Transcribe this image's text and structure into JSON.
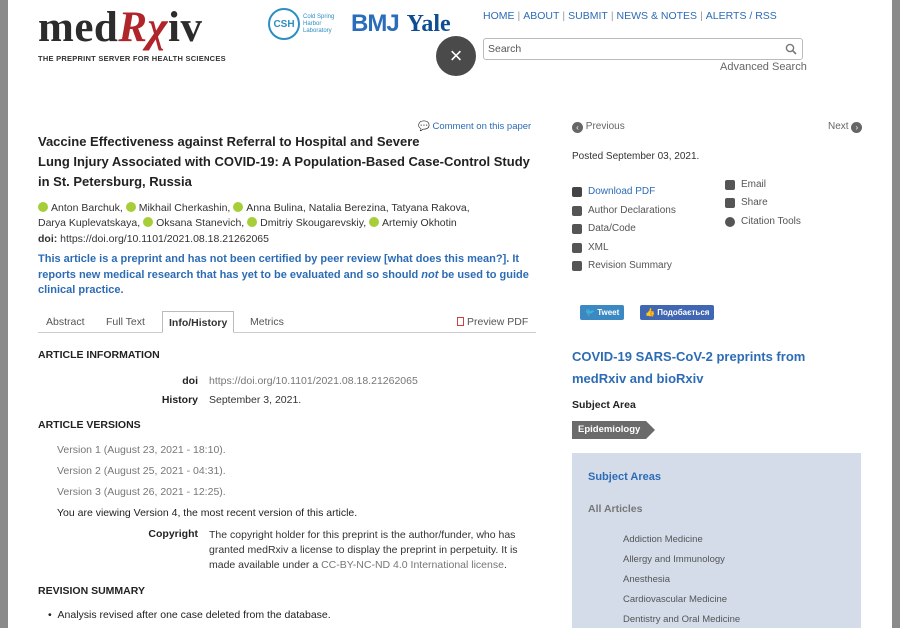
{
  "header": {
    "logo_prefix": "med",
    "logo_rx": "Rχ",
    "logo_suffix": "iv",
    "tagline": "THE PREPRINT SERVER FOR HEALTH SCIENCES",
    "partners": {
      "csh_abbr": "CSH",
      "csh_name": "Cold Spring Harbor Laboratory",
      "bmj": "BMJ",
      "yale": "Yale"
    },
    "nav": [
      "HOME",
      "ABOUT",
      "SUBMIT",
      "NEWS & NOTES",
      "ALERTS / RSS"
    ],
    "close_glyph": "×",
    "search_placeholder": "Search",
    "advanced_search": "Advanced Search"
  },
  "article": {
    "comment_link": "Comment on this paper",
    "title_lines": [
      "Vaccine Effectiveness against Referral to Hospital and Severe",
      "Lung Injury Associated with COVID-19: A Population-Based Case-Control Study",
      "in St. Petersburg, Russia"
    ],
    "authors": [
      "Anton Barchuk",
      "Mikhail Cherkashin",
      "Anna Bulina",
      "Natalia Berezina",
      "Tatyana Rakova",
      "Darya Kuplevatskaya",
      "Oksana Stanevich",
      "Dmitriy Skougarevskiy",
      "Artemiy Okhotin"
    ],
    "authors_line1": [
      "Anton Barchuk,",
      "Mikhail Cherkashin,",
      "Anna Bulina, Natalia Berezina, Tatyana Rakova,"
    ],
    "authors_line2": [
      "Darya Kuplevatskaya,",
      "Oksana Stanevich,",
      "Dmitriy Skougarevskiy,",
      "Artemiy Okhotin"
    ],
    "doi_label": "doi:",
    "doi": "https://doi.org/10.1101/2021.08.18.21262065",
    "warning_1": "This article is a preprint and has not been certified by peer review [what does this mean?]. It reports new medical research that has yet to be evaluated and so should ",
    "warning_not": "not",
    "warning_2": " be used to guide clinical practice.",
    "tabs": [
      "Abstract",
      "Full Text",
      "Info/History",
      "Metrics"
    ],
    "active_tab": "Info/History",
    "preview_pdf": "Preview PDF"
  },
  "info": {
    "article_information_heading": "ARTICLE INFORMATION",
    "doi_key": "doi",
    "doi_value": "https://doi.org/10.1101/2021.08.18.21262065",
    "history_key": "History",
    "history_value": "September 3, 2021.",
    "article_versions_heading": "ARTICLE VERSIONS",
    "versions": [
      "Version 1 (August 23, 2021 - 18:10).",
      "Version 2 (August 25, 2021 - 04:31).",
      "Version 3 (August 26, 2021 - 12:25)."
    ],
    "viewing_note": "You are viewing Version 4, the most recent version of this article.",
    "copyright_key": "Copyright",
    "copyright_text": "The copyright holder for this preprint is the author/funder, who has granted medRxiv a license to display the preprint in perpetuity. It is made available under a ",
    "license": "CC-BY-NC-ND 4.0 International license",
    "copyright_end": ".",
    "revision_summary_heading": "REVISION SUMMARY",
    "revision_items": [
      "Analysis revised after one case deleted from the database."
    ]
  },
  "sidebar": {
    "previous": "Previous",
    "next": "Next",
    "posted": "Posted September 03, 2021.",
    "tools_left": [
      "Download PDF",
      "Author Declarations",
      "Data/Code",
      "XML",
      "Revision Summary"
    ],
    "tools_right": [
      "Email",
      "Share",
      "Citation Tools"
    ],
    "tweet": "Tweet",
    "fb_share": "Подобається",
    "covid_heading": "COVID-19 SARS-CoV-2 preprints from medRxiv and bioRxiv",
    "subject_area_heading": "Subject Area",
    "subject_tag": "Epidemiology",
    "subject_areas_heading": "Subject Areas",
    "all_articles": "All Articles",
    "subject_list": [
      "Addiction Medicine",
      "Allergy and Immunology",
      "Anesthesia",
      "Cardiovascular Medicine",
      "Dentistry and Oral Medicine"
    ]
  },
  "colors": {
    "link_blue": "#2d6cb5",
    "logo_red": "#b0252a",
    "subject_box": "#d4dcea",
    "orcid_green": "#a6ce39"
  }
}
